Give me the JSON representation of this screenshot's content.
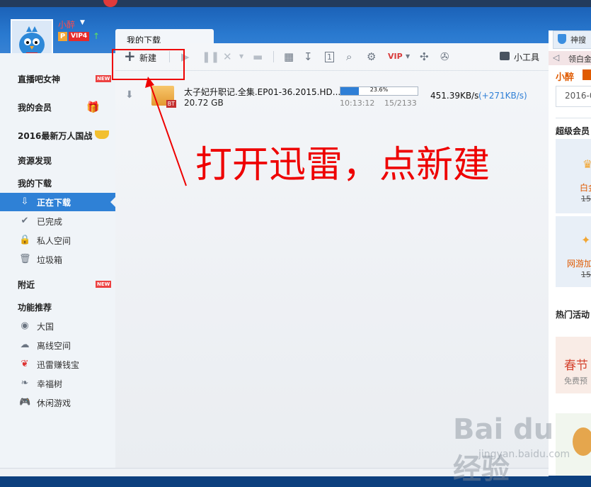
{
  "user": {
    "name": "小醉",
    "p_badge": "P",
    "vip_badge": "VIP4"
  },
  "tab": {
    "label": "我的下载"
  },
  "sidebar": {
    "items": [
      {
        "label": "直播吧女神",
        "badge": "NEW"
      },
      {
        "label": "我的会员"
      },
      {
        "label": "2016最新万人国战"
      },
      {
        "label": "资源发现"
      },
      {
        "label": "我的下载"
      },
      {
        "label": "附近",
        "badge": "NEW"
      },
      {
        "label": "功能推荐"
      }
    ],
    "downloads": [
      {
        "label": "正在下载",
        "icon": "download-icon"
      },
      {
        "label": "已完成",
        "icon": "check-icon"
      },
      {
        "label": "私人空间",
        "icon": "lock-icon"
      },
      {
        "label": "垃圾箱",
        "icon": "trash-icon"
      }
    ],
    "features": [
      {
        "label": "大国",
        "icon": "globe-icon"
      },
      {
        "label": "离线空间",
        "icon": "cloud-icon"
      },
      {
        "label": "迅雷赚钱宝",
        "icon": "money-icon"
      },
      {
        "label": "幸福树",
        "icon": "leaf-icon"
      },
      {
        "label": "休闲游戏",
        "icon": "gamepad-icon"
      }
    ]
  },
  "toolbar": {
    "new_label": "新建",
    "tools_label": "小工具"
  },
  "download": {
    "filename": "太子妃升职记.全集.EP01-36.2015.HD...",
    "size": "20.72 GB",
    "progress_text": "23.6%",
    "progress": 0.236,
    "time": "10:13:12",
    "pieces": "15/2133",
    "speed": "451.39KB/s",
    "speed_up": "(+271KB/s)",
    "type_badge": "BT"
  },
  "right_panel": {
    "search_tab": "神搜",
    "notice": "领白金",
    "user": "小醉",
    "date": "2016-0",
    "section1": "超级会员",
    "item1": "白金",
    "price1": "15",
    "item2": "网游加",
    "price2": "15",
    "section2": "热门活动",
    "promo_title": "春节",
    "promo_sub": "免费预"
  },
  "annotation": {
    "text": "打开迅雷，点新建"
  },
  "watermark": {
    "logo": "Bai du 经验",
    "url": "jingyan.baidu.com"
  }
}
